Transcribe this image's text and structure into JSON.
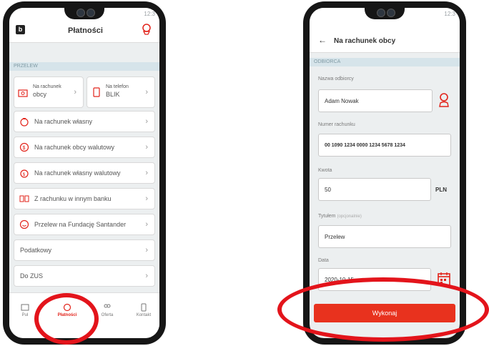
{
  "left_screen": {
    "status_time": "12:3",
    "header_title": "Płatności",
    "section_label": "PRZELEW",
    "quick_tiles": [
      {
        "label_line1": "Na rachunek",
        "label_line2": "obcy"
      },
      {
        "label_line1": "Na telefon",
        "label_line2": "BLIK"
      }
    ],
    "menu_items": [
      {
        "label": "Na rachunek własny"
      },
      {
        "label": "Na rachunek obcy walutowy"
      },
      {
        "label": "Na rachunek własny walutowy"
      },
      {
        "label": "Z rachunku w innym banku"
      },
      {
        "label": "Przelew na Fundację Santander"
      },
      {
        "label": "Podatkowy"
      },
      {
        "label": "Do ZUS"
      }
    ],
    "chevron": "›",
    "bottom_nav": [
      {
        "label": "Pul"
      },
      {
        "label": "Płatności"
      },
      {
        "label": "Oferta"
      },
      {
        "label": "Kontakt"
      }
    ]
  },
  "right_screen": {
    "status_time": "12:3",
    "back_arrow": "←",
    "header_title": "Na rachunek obcy",
    "section_label": "ODBIORCA",
    "recipient_label": "Nazwa odbiorcy",
    "recipient_value": "Adam Nowak",
    "account_label": "Numer rachunku",
    "account_value": "00 1090 1234 0000 1234 5678 1234",
    "amount_label": "Kwota",
    "amount_value": "50",
    "currency": "PLN",
    "title_label": "Tytułem",
    "title_optional": "(opcjonalnie)",
    "title_value": "Przelew",
    "date_label": "Data",
    "date_value": "2020-10-15",
    "submit_label": "Wykonaj"
  },
  "colors": {
    "accent_red": "#e2231a",
    "section_blue": "#d6e4ea",
    "phone_body": "#161616",
    "screen_bg": "#eceff0"
  },
  "icons": {
    "logo": "bank-logo-icon",
    "transfer": "money-bag-icon",
    "contact": "person-icon",
    "calendar": "calendar-icon"
  }
}
